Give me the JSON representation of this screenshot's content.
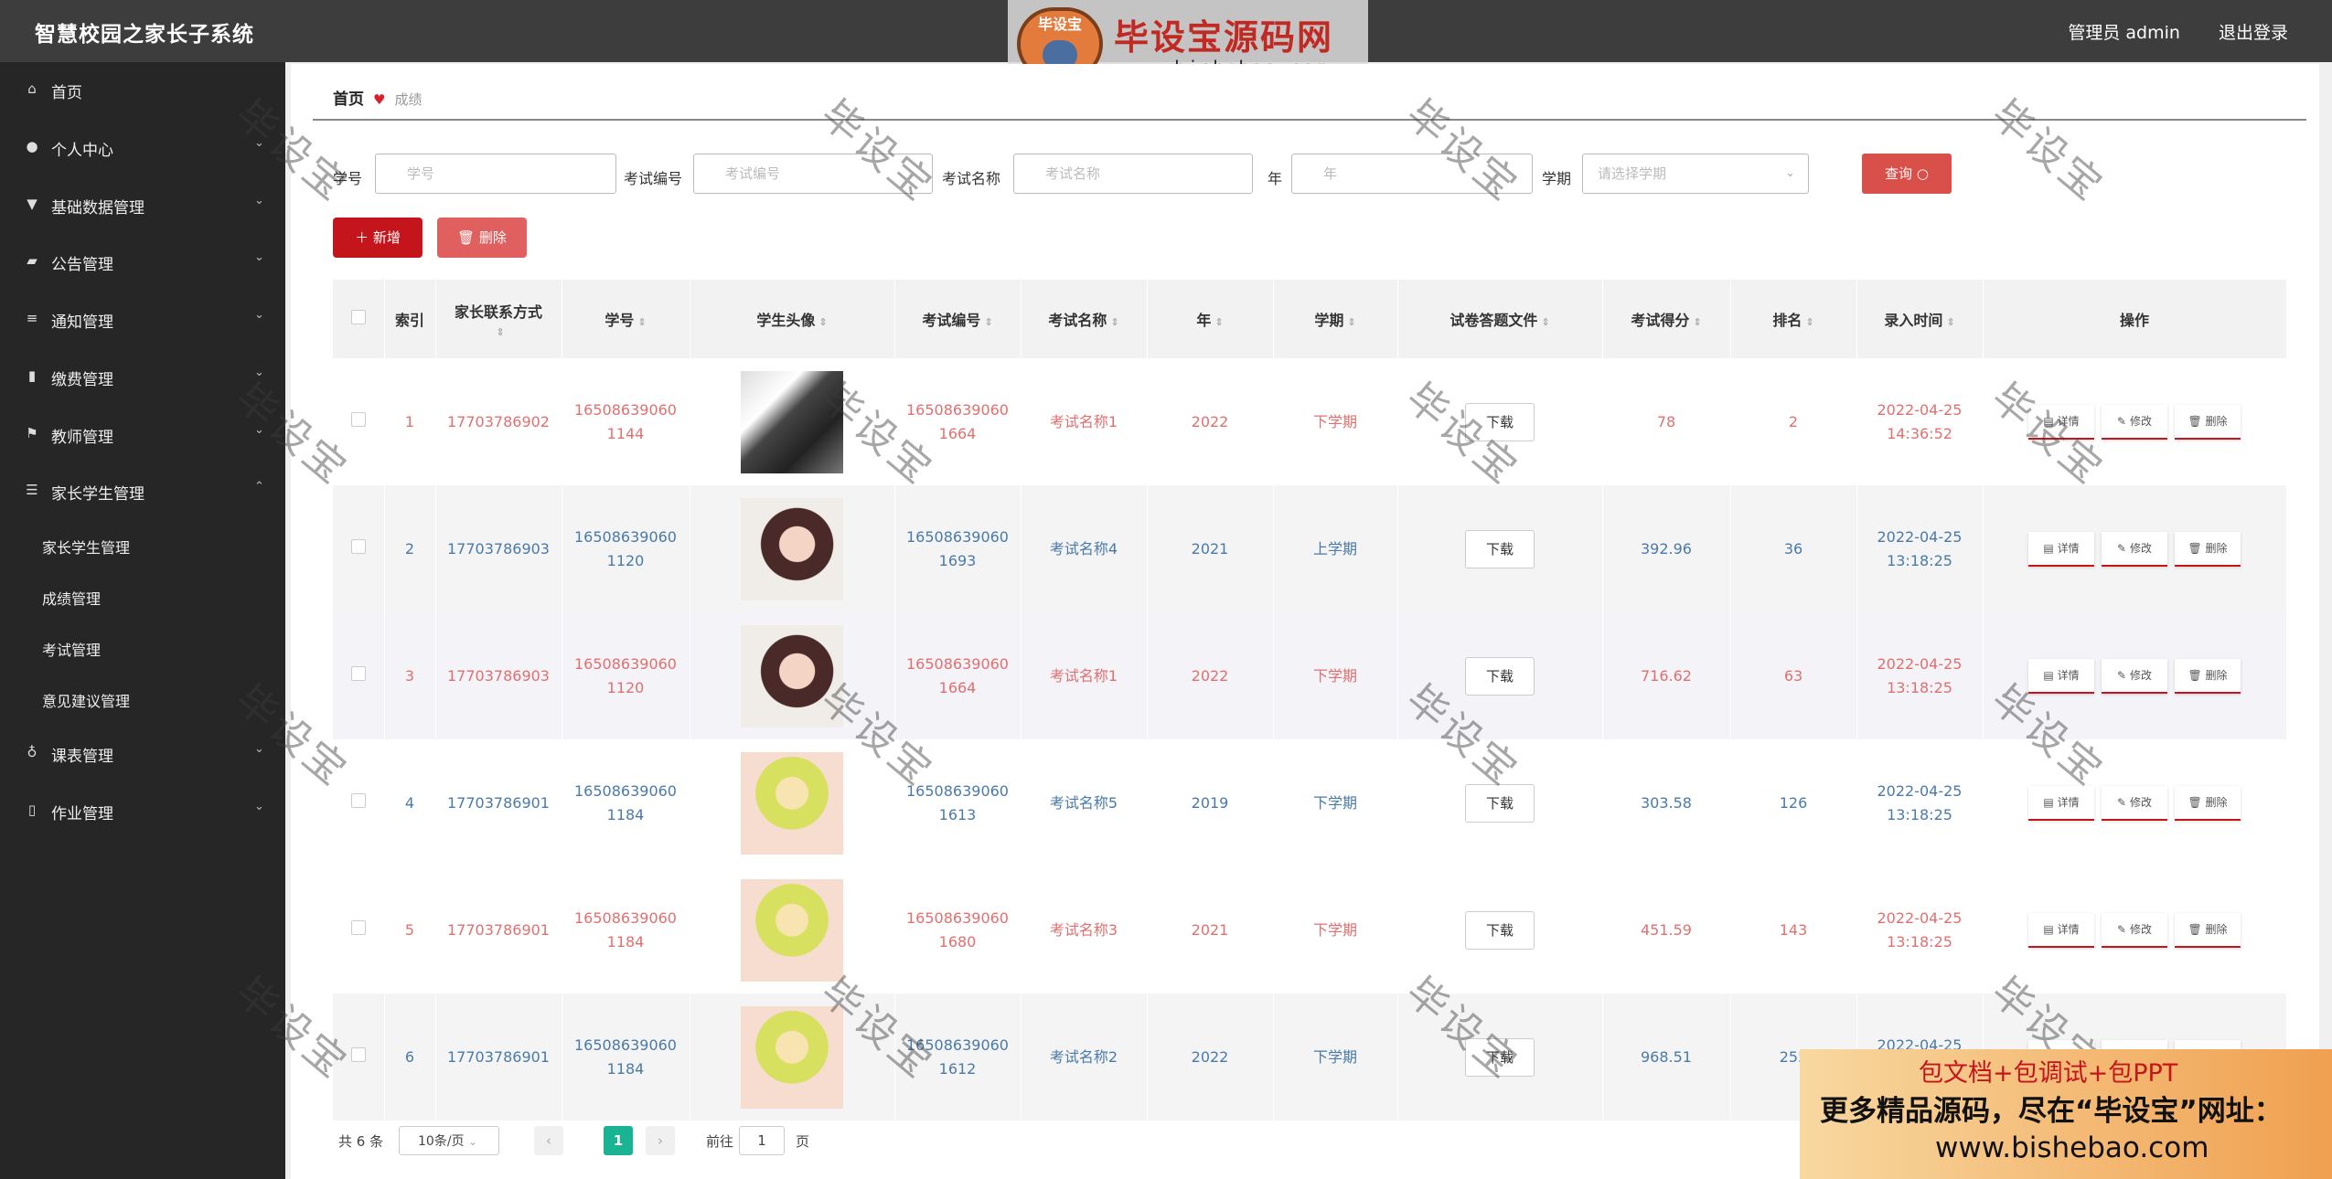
{
  "app": {
    "title": "智慧校园之家长子系统",
    "admin_label": "管理员 admin",
    "logout_label": "退出登录"
  },
  "brand": {
    "badge": "毕设宝",
    "name": "毕设宝源码网",
    "url": "www.bishebao.com"
  },
  "watermark_text": "毕设宝",
  "sidebar": {
    "items": [
      {
        "label": "首页",
        "icon": "home-icon",
        "glyph": "⌂"
      },
      {
        "label": "个人中心",
        "icon": "user-icon",
        "glyph": "●"
      },
      {
        "label": "基础数据管理",
        "icon": "database-icon",
        "glyph": "▼"
      },
      {
        "label": "公告管理",
        "icon": "ticket-icon",
        "glyph": "▰"
      },
      {
        "label": "通知管理",
        "icon": "sliders-icon",
        "glyph": "≡"
      },
      {
        "label": "缴费管理",
        "icon": "bar-chart-icon",
        "glyph": "▮"
      },
      {
        "label": "教师管理",
        "icon": "flag-icon",
        "glyph": "⚑"
      },
      {
        "label": "家长学生管理",
        "icon": "list-icon",
        "glyph": "☰"
      },
      {
        "label": "课表管理",
        "icon": "microphone-icon",
        "glyph": "♁"
      },
      {
        "label": "作业管理",
        "icon": "mobile-icon",
        "glyph": "▯"
      }
    ],
    "sub_items": [
      "家长学生管理",
      "成绩管理",
      "考试管理",
      "意见建议管理"
    ]
  },
  "breadcrumb": {
    "home": "首页",
    "current": "成绩"
  },
  "search": {
    "fields": [
      {
        "label": "学号",
        "placeholder": "学号"
      },
      {
        "label": "考试编号",
        "placeholder": "考试编号"
      },
      {
        "label": "考试名称",
        "placeholder": "考试名称"
      },
      {
        "label": "年",
        "placeholder": "年"
      }
    ],
    "term_label": "学期",
    "term_placeholder": "请选择学期",
    "query_button": "查询"
  },
  "actions": {
    "add": "新增",
    "delete": "删除"
  },
  "table": {
    "headers": [
      "索引",
      "家长联系方式",
      "学号",
      "学生头像",
      "考试编号",
      "考试名称",
      "年",
      "学期",
      "试卷答题文件",
      "考试得分",
      "排名",
      "录入时间",
      "操作"
    ],
    "download_label": "下载",
    "op_labels": [
      "详情",
      "修改",
      "删除"
    ],
    "rows": [
      {
        "index": "1",
        "phone": "17703786902",
        "student_id": "165086390601144",
        "avatar": "av1",
        "exam_id": "165086390601664",
        "exam_name": "考试名称1",
        "year": "2022",
        "term": "下学期",
        "score": "78",
        "rank": "2",
        "time": "2022-04-25 14:36:52",
        "tone": "red"
      },
      {
        "index": "2",
        "phone": "17703786903",
        "student_id": "165086390601120",
        "avatar": "av2",
        "exam_id": "165086390601693",
        "exam_name": "考试名称4",
        "year": "2021",
        "term": "上学期",
        "score": "392.96",
        "rank": "36",
        "time": "2022-04-25 13:18:25",
        "tone": "blue"
      },
      {
        "index": "3",
        "phone": "17703786903",
        "student_id": "165086390601120",
        "avatar": "av2",
        "exam_id": "165086390601664",
        "exam_name": "考试名称1",
        "year": "2022",
        "term": "下学期",
        "score": "716.62",
        "rank": "63",
        "time": "2022-04-25 13:18:25",
        "tone": "red"
      },
      {
        "index": "4",
        "phone": "17703786901",
        "student_id": "165086390601184",
        "avatar": "av3",
        "exam_id": "165086390601613",
        "exam_name": "考试名称5",
        "year": "2019",
        "term": "下学期",
        "score": "303.58",
        "rank": "126",
        "time": "2022-04-25 13:18:25",
        "tone": "blue"
      },
      {
        "index": "5",
        "phone": "17703786901",
        "student_id": "165086390601184",
        "avatar": "av3",
        "exam_id": "165086390601680",
        "exam_name": "考试名称3",
        "year": "2021",
        "term": "下学期",
        "score": "451.59",
        "rank": "143",
        "time": "2022-04-25 13:18:25",
        "tone": "red"
      },
      {
        "index": "6",
        "phone": "17703786901",
        "student_id": "165086390601184",
        "avatar": "av3",
        "exam_id": "165086390601612",
        "exam_name": "考试名称2",
        "year": "2022",
        "term": "下学期",
        "score": "968.51",
        "rank": "255",
        "time": "2022-04-25 13:",
        "tone": "blue"
      }
    ]
  },
  "pagination": {
    "total": "共 6 条",
    "page_size": "10条/页",
    "prev": "‹",
    "current": "1",
    "next": "›",
    "goto_label": "前往",
    "goto_value": "1",
    "page_suffix": "页"
  },
  "promo": {
    "line1": "包文档+包调试+包PPT",
    "line2": "更多精品源码，尽在“毕设宝”网址：",
    "line3": "www.bishebao.com"
  },
  "colors": {
    "accent": "#c4151c",
    "sidebar_bg": "#262626",
    "topbar_bg": "#3d3d3d",
    "page_active": "#1ab394"
  }
}
